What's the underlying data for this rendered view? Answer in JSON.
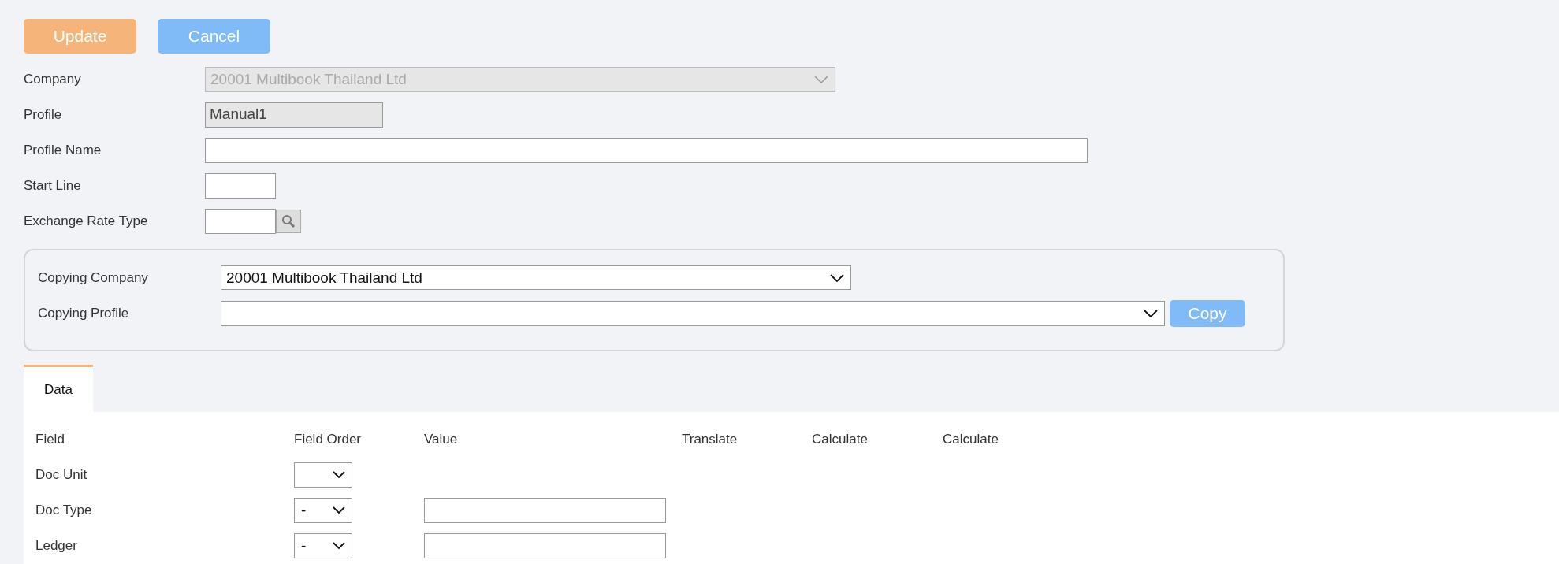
{
  "actions": [
    {
      "label": "Update",
      "kind": "primary"
    },
    {
      "label": "Cancel",
      "kind": "secondary"
    }
  ],
  "form": [
    {
      "label": "Company",
      "kind": "select",
      "value": "20001 Multibook Thailand Ltd",
      "disabled": true
    },
    {
      "label": "Profile",
      "kind": "text",
      "value": "Manual1",
      "disabled": true
    },
    {
      "label": "Profile Name",
      "kind": "wide_text",
      "disabled": false
    },
    {
      "label": "Start Line",
      "kind": "short_text",
      "disabled": false
    },
    {
      "label": "Exchange Rate Type",
      "kind": "lookup",
      "disabled": false
    }
  ],
  "copy_panel": {
    "company": {
      "label": "Copying Company",
      "value": "20001 Multibook Thailand Ltd"
    },
    "profile": {
      "label": "Copying Profile"
    },
    "copy_button": "Copy"
  },
  "tabs": [
    {
      "label": "Data",
      "selected": true
    }
  ],
  "table": {
    "columns": [
      "Field",
      "Field Order",
      "Value",
      "Translate",
      "Calculate",
      "Calculate"
    ],
    "rows": [
      {
        "field": "Doc Unit",
        "order": "",
        "has_value": false
      },
      {
        "field": "Doc Type",
        "order": "-",
        "has_value": true
      },
      {
        "field": "Ledger",
        "order": "-",
        "has_value": true
      }
    ]
  }
}
